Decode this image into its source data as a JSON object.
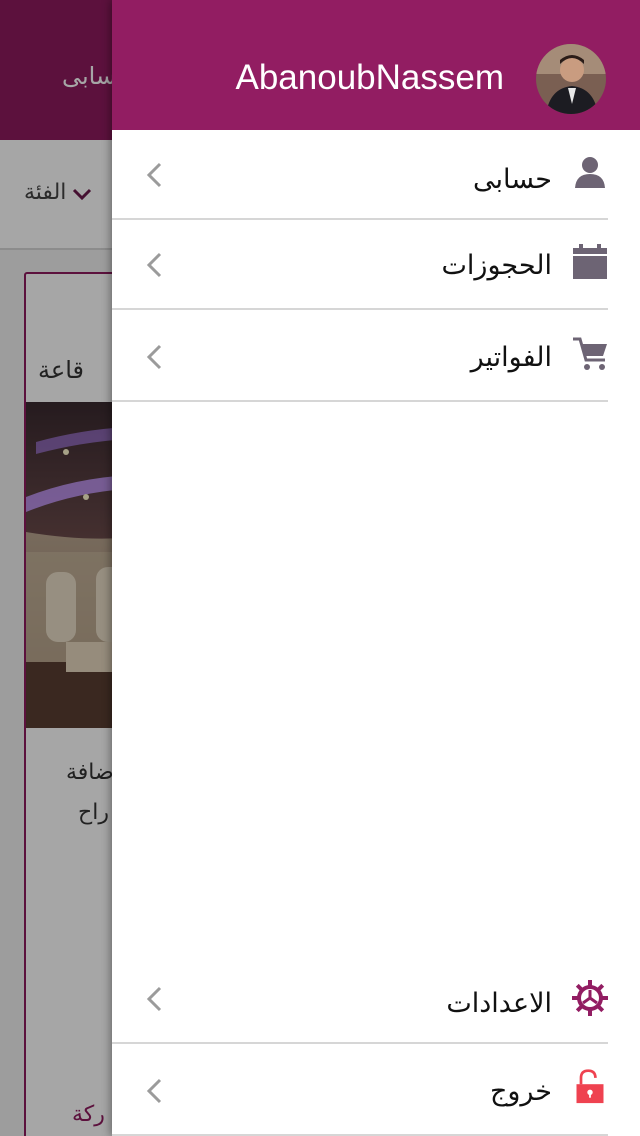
{
  "background": {
    "header_title": "حسابى",
    "filter_label": "الفئة",
    "card": {
      "type_label": "قاعة",
      "line1": "ضافة",
      "line2": "راح",
      "link": "ركة"
    }
  },
  "drawer": {
    "username": "AbanoubNassem",
    "menu": [
      {
        "label": "حسابى",
        "icon": "person-icon"
      },
      {
        "label": "الحجوزات",
        "icon": "calendar-icon"
      },
      {
        "label": "الفواتير",
        "icon": "cart-icon"
      }
    ],
    "bottom_menu": [
      {
        "label": "الاعدادات",
        "icon": "settings-gear-icon"
      },
      {
        "label": "خروج",
        "icon": "unlock-icon"
      }
    ]
  },
  "colors": {
    "primary": "#921d62",
    "icon_gray": "#6d6474",
    "logout_red": "#ef4250"
  }
}
